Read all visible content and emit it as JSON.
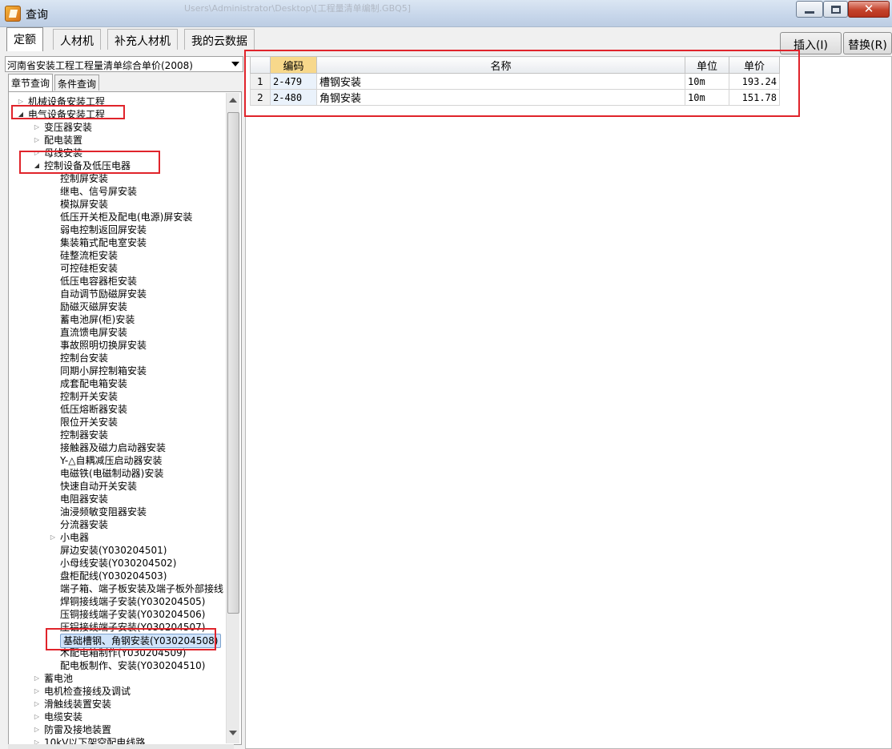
{
  "window": {
    "title": "查询",
    "background_title": "Users\\Administrator\\Desktop\\[工程量清单编制.GBQ5]"
  },
  "tabs": [
    "定额",
    "人材机",
    "补充人材机",
    "我的云数据"
  ],
  "toolbar": {
    "insert_label": "插入(I)",
    "replace_label": "替换(R)"
  },
  "left": {
    "dataset_select": "河南省安装工程工程量清单综合单价(2008)",
    "subtabs": [
      "章节查询",
      "条件查询"
    ],
    "tree": [
      {
        "label": "机械设备安装工程",
        "level": 0,
        "state": "closed"
      },
      {
        "label": "电气设备安装工程",
        "level": 0,
        "state": "open"
      },
      {
        "label": "变压器安装",
        "level": 1,
        "state": "closed"
      },
      {
        "label": "配电装置",
        "level": 1,
        "state": "closed"
      },
      {
        "label": "母线安装",
        "level": 1,
        "state": "closed"
      },
      {
        "label": "控制设备及低压电器",
        "level": 1,
        "state": "open"
      },
      {
        "label": "控制屏安装",
        "level": 2,
        "state": "leaf"
      },
      {
        "label": "继电、信号屏安装",
        "level": 2,
        "state": "leaf"
      },
      {
        "label": "模拟屏安装",
        "level": 2,
        "state": "leaf"
      },
      {
        "label": "低压开关柜及配电(电源)屏安装",
        "level": 2,
        "state": "leaf"
      },
      {
        "label": "弱电控制返回屏安装",
        "level": 2,
        "state": "leaf"
      },
      {
        "label": "集装箱式配电室安装",
        "level": 2,
        "state": "leaf"
      },
      {
        "label": "硅整流柜安装",
        "level": 2,
        "state": "leaf"
      },
      {
        "label": "可控硅柜安装",
        "level": 2,
        "state": "leaf"
      },
      {
        "label": "低压电容器柜安装",
        "level": 2,
        "state": "leaf"
      },
      {
        "label": "自动调节励磁屏安装",
        "level": 2,
        "state": "leaf"
      },
      {
        "label": "励磁灭磁屏安装",
        "level": 2,
        "state": "leaf"
      },
      {
        "label": "蓄电池屏(柜)安装",
        "level": 2,
        "state": "leaf"
      },
      {
        "label": "直流馈电屏安装",
        "level": 2,
        "state": "leaf"
      },
      {
        "label": "事故照明切换屏安装",
        "level": 2,
        "state": "leaf"
      },
      {
        "label": "控制台安装",
        "level": 2,
        "state": "leaf"
      },
      {
        "label": "同期小屏控制箱安装",
        "level": 2,
        "state": "leaf"
      },
      {
        "label": "成套配电箱安装",
        "level": 2,
        "state": "leaf"
      },
      {
        "label": "控制开关安装",
        "level": 2,
        "state": "leaf"
      },
      {
        "label": "低压熔断器安装",
        "level": 2,
        "state": "leaf"
      },
      {
        "label": "限位开关安装",
        "level": 2,
        "state": "leaf"
      },
      {
        "label": "控制器安装",
        "level": 2,
        "state": "leaf"
      },
      {
        "label": "接触器及磁力启动器安装",
        "level": 2,
        "state": "leaf"
      },
      {
        "label": "Y-△自耦减压启动器安装",
        "level": 2,
        "state": "leaf"
      },
      {
        "label": "电磁铁(电磁制动器)安装",
        "level": 2,
        "state": "leaf"
      },
      {
        "label": "快速自动开关安装",
        "level": 2,
        "state": "leaf"
      },
      {
        "label": "电阻器安装",
        "level": 2,
        "state": "leaf"
      },
      {
        "label": "油浸频敏变阻器安装",
        "level": 2,
        "state": "leaf"
      },
      {
        "label": "分流器安装",
        "level": 2,
        "state": "leaf"
      },
      {
        "label": "小电器",
        "level": 2,
        "state": "closed"
      },
      {
        "label": "屏边安装(Y030204501)",
        "level": 2,
        "state": "leaf"
      },
      {
        "label": "小母线安装(Y030204502)",
        "level": 2,
        "state": "leaf"
      },
      {
        "label": "盘柜配线(Y030204503)",
        "level": 2,
        "state": "leaf"
      },
      {
        "label": "端子箱、端子板安装及端子板外部接线",
        "level": 2,
        "state": "leaf"
      },
      {
        "label": "焊铜接线端子安装(Y030204505)",
        "level": 2,
        "state": "leaf"
      },
      {
        "label": "压铜接线端子安装(Y030204506)",
        "level": 2,
        "state": "leaf"
      },
      {
        "label": "压铝接线端子安装(Y030204507)",
        "level": 2,
        "state": "leaf"
      },
      {
        "label": "基础槽钢、角钢安装(Y030204508)",
        "level": 2,
        "state": "leaf",
        "selected": true
      },
      {
        "label": "木配电箱制作(Y030204509)",
        "level": 2,
        "state": "leaf"
      },
      {
        "label": "配电板制作、安装(Y030204510)",
        "level": 2,
        "state": "leaf"
      },
      {
        "label": "蓄电池",
        "level": 1,
        "state": "closed"
      },
      {
        "label": "电机检查接线及调试",
        "level": 1,
        "state": "closed"
      },
      {
        "label": "滑触线装置安装",
        "level": 1,
        "state": "closed"
      },
      {
        "label": "电缆安装",
        "level": 1,
        "state": "closed"
      },
      {
        "label": "防雷及接地装置",
        "level": 1,
        "state": "closed"
      },
      {
        "label": "10kV以下架空配电线路",
        "level": 1,
        "state": "closed"
      }
    ]
  },
  "grid": {
    "columns": [
      "编码",
      "名称",
      "单位",
      "单价"
    ],
    "rows": [
      {
        "num": "1",
        "code": "2-479",
        "name": "槽钢安装",
        "unit": "10m",
        "price": "193.24"
      },
      {
        "num": "2",
        "code": "2-480",
        "name": "角钢安装",
        "unit": "10m",
        "price": "151.78"
      }
    ]
  },
  "colors": {
    "annotation_red": "#e0242b",
    "header_highlight": "#f7d88b",
    "selection": "#cfe3fa"
  }
}
